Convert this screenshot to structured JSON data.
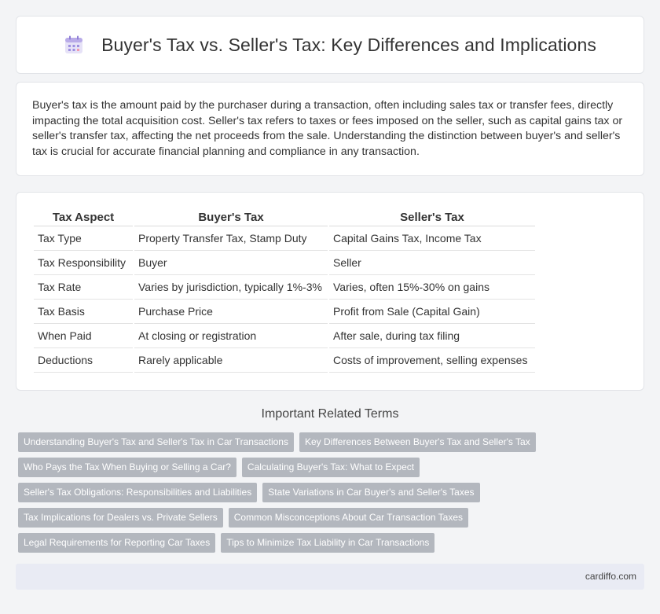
{
  "header": {
    "title": "Buyer's Tax vs. Seller's Tax: Key Differences and Implications",
    "icon": "calendar-icon"
  },
  "intro": {
    "text": "Buyer's tax is the amount paid by the purchaser during a transaction, often including sales tax or transfer fees, directly impacting the total acquisition cost. Seller's tax refers to taxes or fees imposed on the seller, such as capital gains tax or seller's transfer tax, affecting the net proceeds from the sale. Understanding the distinction between buyer's and seller's tax is crucial for accurate financial planning and compliance in any transaction."
  },
  "table": {
    "headers": [
      "Tax Aspect",
      "Buyer's Tax",
      "Seller's Tax"
    ],
    "rows": [
      [
        "Tax Type",
        "Property Transfer Tax, Stamp Duty",
        "Capital Gains Tax, Income Tax"
      ],
      [
        "Tax Responsibility",
        "Buyer",
        "Seller"
      ],
      [
        "Tax Rate",
        "Varies by jurisdiction, typically 1%-3%",
        "Varies, often 15%-30% on gains"
      ],
      [
        "Tax Basis",
        "Purchase Price",
        "Profit from Sale (Capital Gain)"
      ],
      [
        "When Paid",
        "At closing or registration",
        "After sale, during tax filing"
      ],
      [
        "Deductions",
        "Rarely applicable",
        "Costs of improvement, selling expenses"
      ]
    ]
  },
  "related": {
    "title": "Important Related Terms",
    "tags": [
      "Understanding Buyer's Tax and Seller's Tax in Car Transactions",
      "Key Differences Between Buyer's Tax and Seller's Tax",
      "Who Pays the Tax When Buying or Selling a Car?",
      "Calculating Buyer's Tax: What to Expect",
      "Seller's Tax Obligations: Responsibilities and Liabilities",
      "State Variations in Car Buyer's and Seller's Taxes",
      "Tax Implications for Dealers vs. Private Sellers",
      "Common Misconceptions About Car Transaction Taxes",
      "Legal Requirements for Reporting Car Taxes",
      "Tips to Minimize Tax Liability in Car Transactions"
    ]
  },
  "footer": {
    "site": "cardiffo.com"
  }
}
